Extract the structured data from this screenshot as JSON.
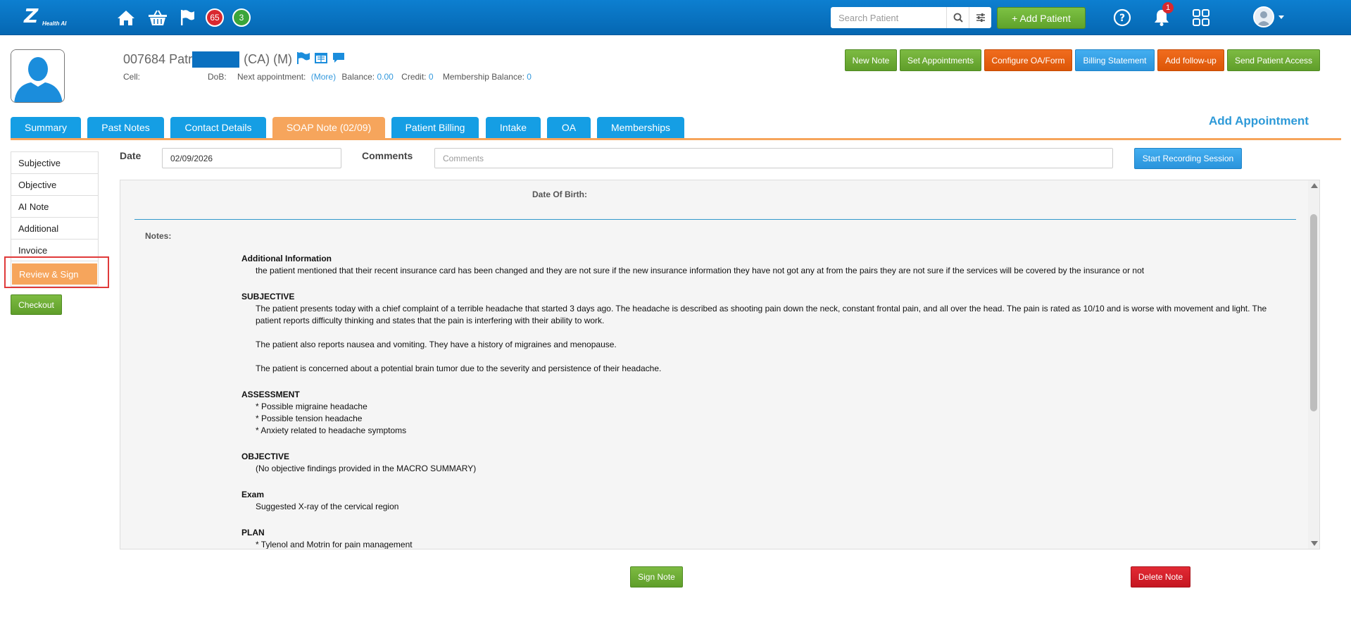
{
  "topbar": {
    "logo_text": "Z",
    "logo_sub": "Health AI",
    "badge_red": "65",
    "badge_green": "3",
    "search_placeholder": "Search Patient",
    "add_patient_label": "+ Add Patient",
    "notification_count": "1",
    "icons": [
      "home-icon",
      "basket-icon",
      "flag-icon",
      "search-icon",
      "sliders-icon",
      "help-icon",
      "bell-icon",
      "apps-grid-icon",
      "user-avatar-icon",
      "chevron-down-icon"
    ]
  },
  "patient": {
    "name_prefix": "007684 Patr",
    "name_suffix": "(CA) (M)",
    "cell_label": "Cell:",
    "dob_label": "DoB:",
    "next_appt_label": "Next appointment:",
    "more_link": "(More)",
    "balance_label": "Balance:",
    "balance_value": "0.00",
    "credit_label": "Credit:",
    "credit_value": "0",
    "membership_label": "Membership Balance:",
    "membership_value": "0"
  },
  "actions": {
    "new_note": "New Note",
    "set_appointments": "Set Appointments",
    "configure_oa": "Configure OA/Form",
    "billing_statement": "Billing Statement",
    "add_followup": "Add follow-up",
    "send_access": "Send Patient Access"
  },
  "tabs": [
    {
      "label": "Summary"
    },
    {
      "label": "Past Notes"
    },
    {
      "label": "Contact Details"
    },
    {
      "label": "SOAP Note (02/09)"
    },
    {
      "label": "Patient Billing"
    },
    {
      "label": "Intake"
    },
    {
      "label": "OA"
    },
    {
      "label": "Memberships"
    }
  ],
  "add_appointment": "Add Appointment",
  "left_menu": [
    {
      "label": "Subjective"
    },
    {
      "label": "Objective"
    },
    {
      "label": "AI Note"
    },
    {
      "label": "Additional"
    },
    {
      "label": "Invoice"
    },
    {
      "label": "Review & Sign"
    }
  ],
  "checkout_label": "Checkout",
  "form": {
    "date_label": "Date",
    "date_value": "02/09/2026",
    "comments_label": "Comments",
    "comments_placeholder": "Comments",
    "start_recording": "Start Recording Session"
  },
  "note": {
    "dob_label": "Date Of Birth:",
    "notes_label": "Notes:",
    "additional_head": "Additional Information",
    "additional_text": "the patient mentioned that their recent insurance card has been changed and they are not sure if the new insurance information they have not got any at from the pairs they are not sure if the services will be covered by the insurance or not",
    "subjective_head": "SUBJECTIVE",
    "subjective_p1": "The patient presents today with a chief complaint of a terrible headache that started 3 days ago. The headache is described as shooting pain down the neck, constant frontal pain, and all over the head. The pain is rated as 10/10 and is worse with movement and light. The patient reports difficulty thinking and states that the pain is interfering with their ability to work.",
    "subjective_p2": "The patient also reports nausea and vomiting. They have a history of migraines and menopause.",
    "subjective_p3": "The patient is concerned about a potential brain tumor due to the severity and persistence of their headache.",
    "assessment_head": "ASSESSMENT",
    "assessment_items": [
      "*  Possible migraine headache",
      "*  Possible tension headache",
      "*  Anxiety related to headache symptoms"
    ],
    "objective_head": "OBJECTIVE",
    "objective_text": "(No objective findings provided in the MACRO SUMMARY)",
    "exam_head": "Exam",
    "exam_text": "Suggested X-ray of the cervical region",
    "plan_head": "PLAN",
    "plan_items": [
      "*  Tylenol and Motrin for pain management"
    ]
  },
  "footer": {
    "sign_note": "Sign Note",
    "delete_note": "Delete Note"
  }
}
